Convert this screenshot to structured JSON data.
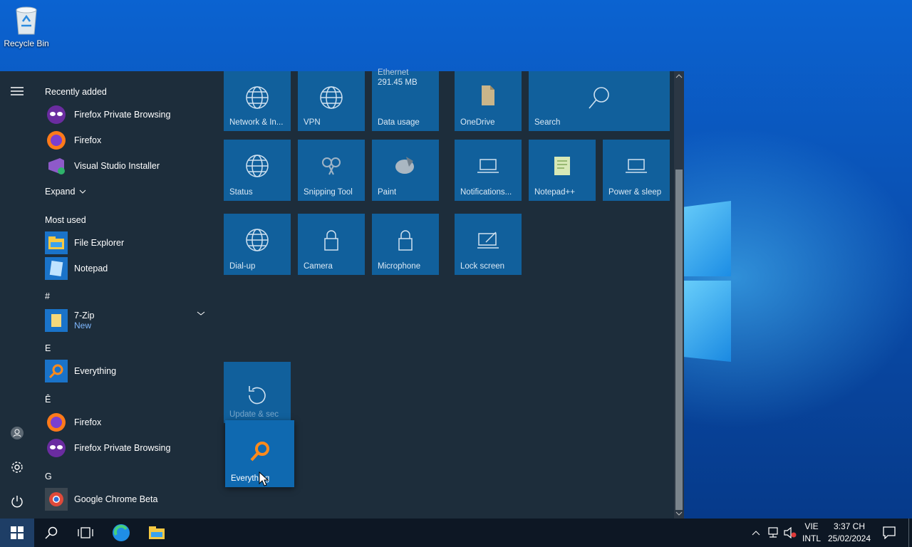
{
  "desktop": {
    "recycle_bin_label": "Recycle Bin"
  },
  "start_menu": {
    "sections": {
      "recently_added": "Recently added",
      "expand": "Expand",
      "most_used": "Most used",
      "hash": "#",
      "e": "E",
      "e_circ": "Ê",
      "g": "G"
    },
    "recent": [
      {
        "name": "Firefox Private Browsing",
        "icon": "firefox-private-icon"
      },
      {
        "name": "Firefox",
        "icon": "firefox-icon"
      },
      {
        "name": "Visual Studio Installer",
        "icon": "visual-studio-installer-icon"
      }
    ],
    "most_used": [
      {
        "name": "File Explorer",
        "icon": "file-explorer-icon"
      },
      {
        "name": "Notepad",
        "icon": "notepad-icon"
      }
    ],
    "zip": {
      "name": "7-Zip",
      "status": "New"
    },
    "everything": "Everything",
    "e_apps": [
      "Firefox",
      "Firefox Private Browsing"
    ],
    "g_apps": [
      "Google Chrome Beta"
    ],
    "tiles": {
      "network": "Network & In...",
      "vpn": "VPN",
      "data_usage_title": "Ethernet",
      "data_usage_value": "291.45 MB",
      "data_usage": "Data usage",
      "onedrive": "OneDrive",
      "search": "Search",
      "status": "Status",
      "snipping": "Snipping Tool",
      "paint": "Paint",
      "notifications": "Notifications...",
      "notepadpp": "Notepad++",
      "power": "Power & sleep",
      "dialup": "Dial-up",
      "camera": "Camera",
      "microphone": "Microphone",
      "lockscreen": "Lock screen",
      "update": "Update & sec",
      "everything": "Everything"
    }
  },
  "taskbar": {
    "lang_top": "VIE",
    "lang_bottom": "INTL",
    "time": "3:37 CH",
    "date": "25/02/2024"
  },
  "colors": {
    "start_bg": "#1d2d3b",
    "tile_bg": "#11609c",
    "taskbar_bg": "#0d1724"
  }
}
